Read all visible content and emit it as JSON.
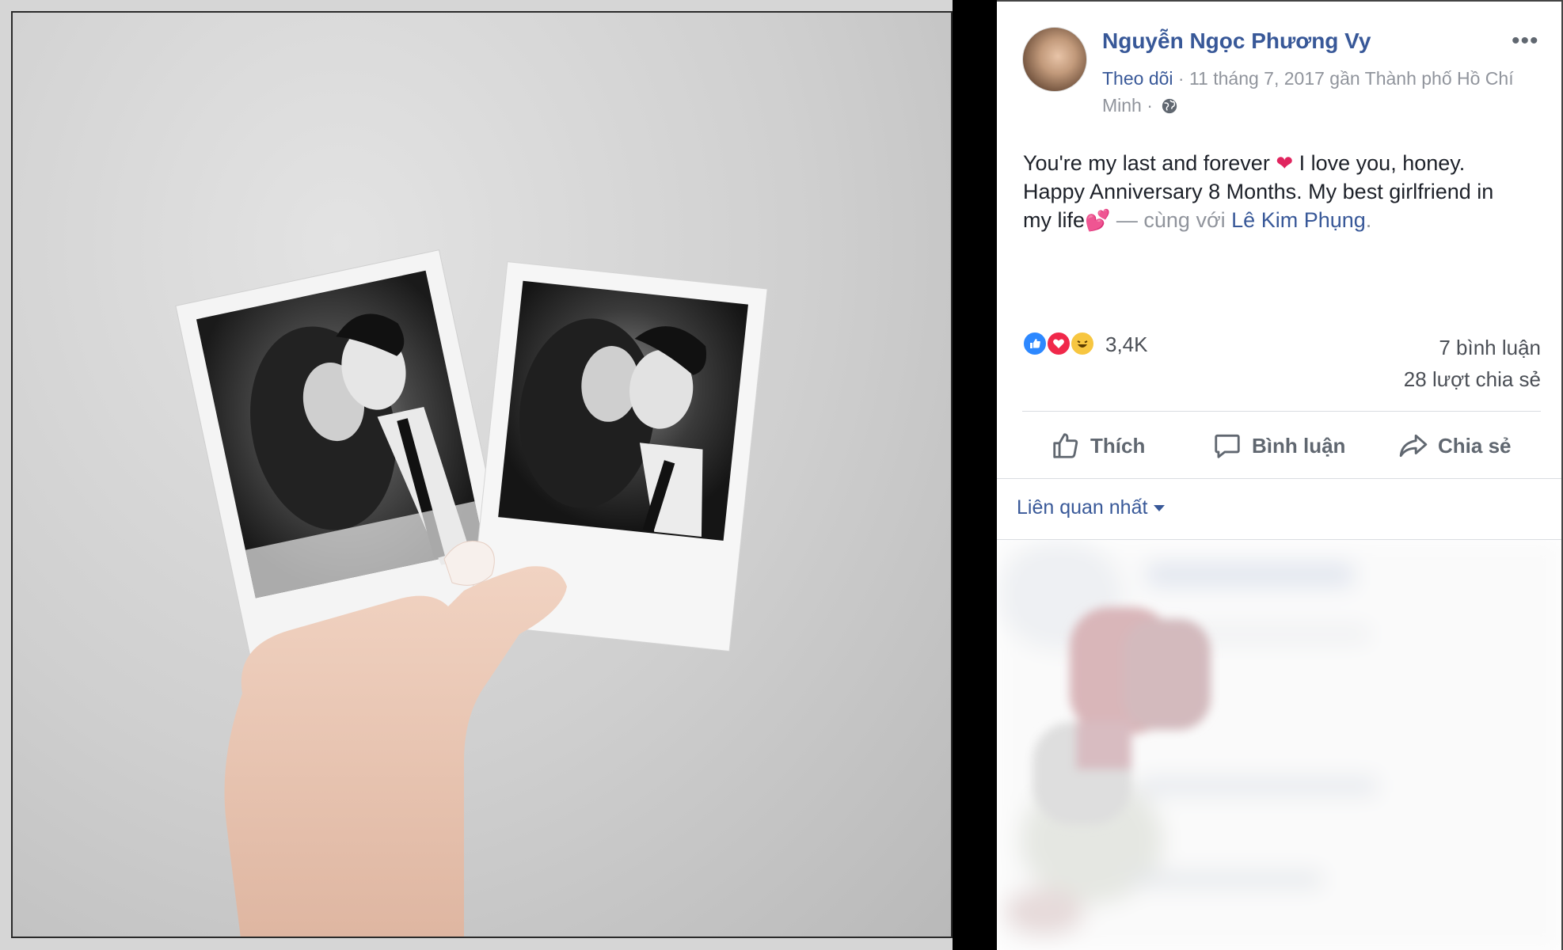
{
  "post": {
    "author": "Nguyễn Ngọc Phương Vy",
    "follow_label": "Theo dõi",
    "meta_text": " · 11 tháng 7, 2017 gần Thành phố Hồ Chí Minh · ",
    "text_line1": "You're my last and forever ",
    "text_line1b": " I love you, honey.",
    "text_line2": "Happy Anniversary 8 Months. My best girlfriend in",
    "text_line3": "my life",
    "with_text": " — cùng với ",
    "tagged_person": "Lê Kim Phụng",
    "tagged_suffix": ".",
    "heart_emoji": "❤",
    "hearts_emoji": "💕",
    "more_icon": "•••"
  },
  "stats": {
    "reaction_count": "3,4K",
    "comments": "7 bình luận",
    "shares": "28 lượt chia sẻ",
    "reaction_icons": [
      "like-icon",
      "love-icon",
      "haha-icon"
    ]
  },
  "actions": {
    "like_label": "Thích",
    "comment_label": "Bình luận",
    "share_label": "Chia sẻ"
  },
  "comments": {
    "sort_label": "Liên quan nhất"
  },
  "colors": {
    "link": "#385898",
    "muted": "#90949c",
    "text": "#1d2129"
  }
}
